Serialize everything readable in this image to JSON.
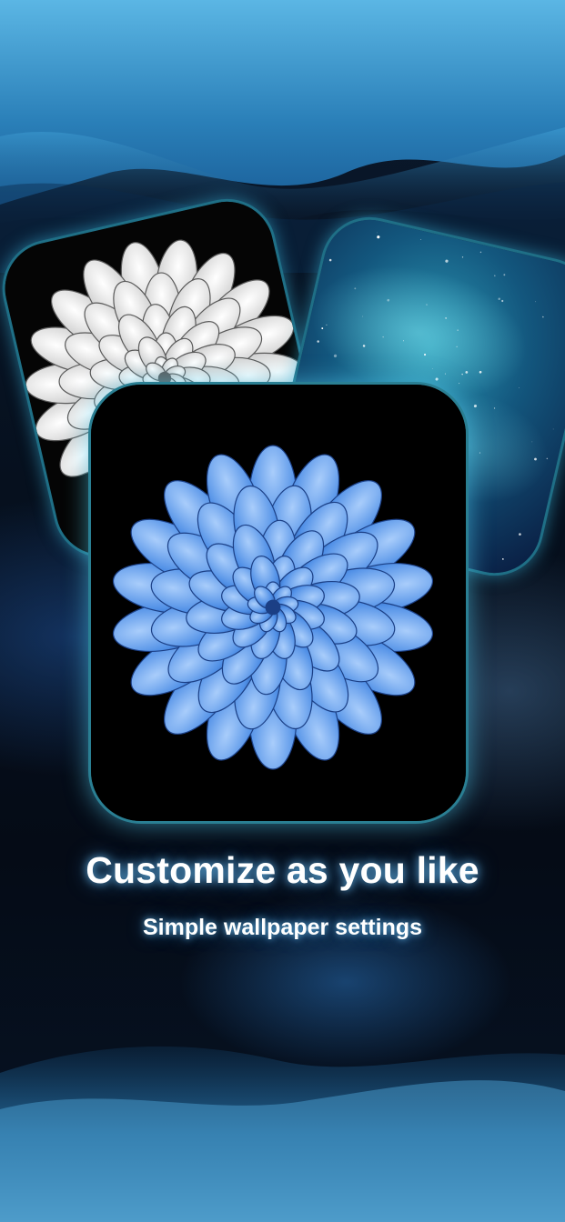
{
  "onboarding": {
    "title": "Customize as you like",
    "subtitle": "Simple wallpaper settings"
  },
  "preview_cards": [
    {
      "name": "white-flower-wallpaper",
      "icon": "white-dahlia"
    },
    {
      "name": "galaxy-wallpaper",
      "icon": "starry-galaxy"
    },
    {
      "name": "blue-flower-wallpaper",
      "icon": "blue-dahlia"
    }
  ],
  "colors": {
    "accent_glow": "#3cbee6",
    "card_border": "#1f6f86",
    "text": "#ffffff",
    "sky_top": "#5bb6e4"
  }
}
